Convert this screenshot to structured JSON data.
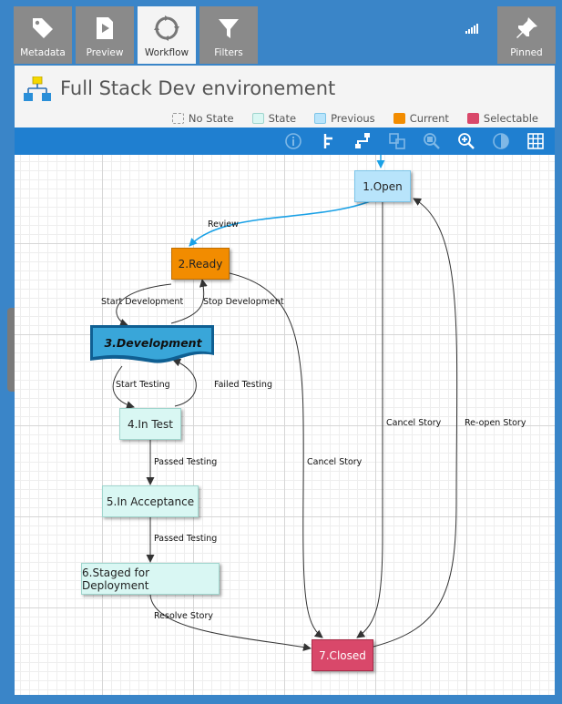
{
  "tabs": [
    {
      "label": "Metadata",
      "icon": "tag-icon",
      "active": false
    },
    {
      "label": "Preview",
      "icon": "play-icon",
      "active": false
    },
    {
      "label": "Workflow",
      "icon": "refresh-icon",
      "active": true
    },
    {
      "label": "Filters",
      "icon": "funnel-icon",
      "active": false
    }
  ],
  "pinned_label": "Pinned",
  "title": "Full Stack Dev environement",
  "legend": [
    {
      "label": "No State",
      "color": "#ffffff"
    },
    {
      "label": "State",
      "color": "#d9f7f3"
    },
    {
      "label": "Previous",
      "color": "#b8e4fb"
    },
    {
      "label": "Current",
      "color": "#f28c00"
    },
    {
      "label": "Selectable",
      "color": "#d9486a"
    }
  ],
  "toolbar_icons": [
    "info-icon",
    "align-tree-icon",
    "layout-icon",
    "copy-icon",
    "zoom-fit-icon",
    "zoom-in-icon",
    "overview-icon",
    "grid-icon"
  ],
  "states": {
    "open": "1.Open",
    "ready": "2.Ready",
    "development": "3.Development",
    "in_test": "4.In Test",
    "in_acceptance": "5.In Acceptance",
    "staged": "6.Staged for Deployment",
    "closed": "7.Closed"
  },
  "transitions": {
    "review": "Review",
    "start_development": "Start Development",
    "stop_development": "Stop Development",
    "start_testing": "Start Testing",
    "failed_testing": "Failed Testing",
    "passed_testing_1": "Passed Testing",
    "passed_testing_2": "Passed Testing",
    "resolve_story": "Resolve Story",
    "cancel_story_ready": "Cancel Story",
    "cancel_story_open": "Cancel Story",
    "reopen_story": "Re-open Story"
  },
  "colors": {
    "accent": "#3a85c8",
    "toolbar": "#1f7fd0",
    "state_fill": "#d9f7f3",
    "previous_fill": "#b8e4fb",
    "current_fill": "#f28c00",
    "selectable_fill": "#d9486a",
    "development_fill": "#39a6d9",
    "review_edge": "#1aa1e6"
  }
}
